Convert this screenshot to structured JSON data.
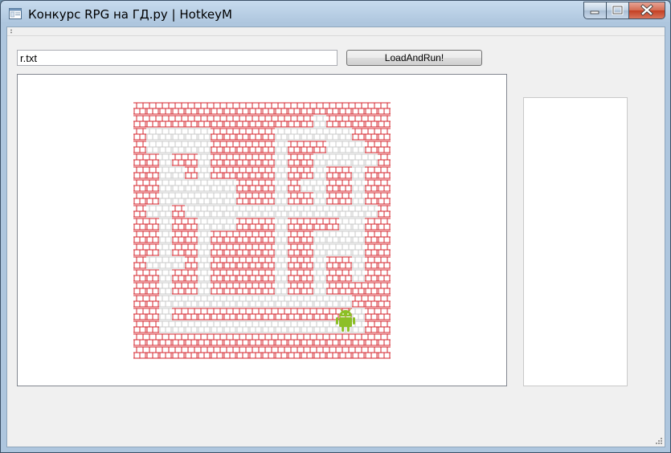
{
  "window": {
    "title": "Конкурс RPG на ГД.ру | HotkeyM"
  },
  "toolbar": {
    "file_value": "r.txt",
    "run_label": "LoadAndRun!"
  },
  "colors": {
    "wall": "#d4242c",
    "floor": "#c8c8c8",
    "robot": "#8cbf26"
  },
  "maze": {
    "rows": [
      "WWWWWWWWWWWWWWWWWWWW",
      "WWWWWWWWWWWWWWFWWWWW",
      "WFFFFFWWWWWFFFFFFWWW",
      "WFFFFFWWWWWFWWWFFFWW",
      "WWFWWFWWWWWFWWFFFFFW",
      "WWFFWFWWWWWFWWFWWFWW",
      "WWFFFFFFWWWFWFFWWFWW",
      "WWFFFFFFWWWFWWFWWFWW",
      "WFFWFFFFFFFFFFFFFFFW",
      "WWFWWFFFWWWFWWWWFFWW",
      "WWFWWFWWWWWFWWFFFFWW",
      "WWFWWFWWWWWFWWFFFFWW",
      "WFFFWFWWWWWFWWFWWFWW",
      "WWFWWFWWWWWFWWFWWFWW",
      "WWFWWFWWWWWFWWFWWWWW",
      "WWFFFFFFFFFFFFFFFWWW",
      "WWFWWWWWWWWWWWWWWFWW",
      "WWFFFFFFFFFFFFFFFFWW",
      "WWWWWWWWWWWWWWWWWWWW",
      "WWWWWWWWWWWWWWWWWWWW"
    ],
    "robot": {
      "row": 17,
      "col": 16,
      "icon": "android-robot-icon"
    }
  }
}
